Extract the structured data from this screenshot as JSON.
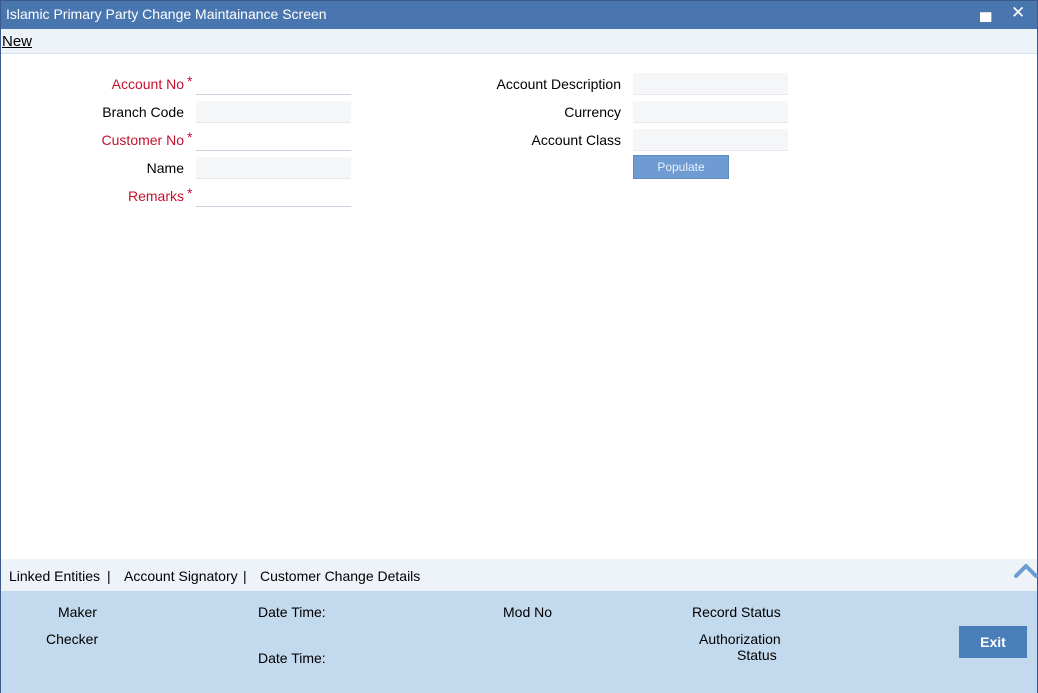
{
  "window": {
    "title": "Islamic Primary Party Change Maintainance Screen",
    "minimize_glyph": "▄",
    "close_glyph": "✕"
  },
  "toolbar": {
    "new_label": "New"
  },
  "form": {
    "account_no": {
      "label": "Account No",
      "value": ""
    },
    "branch_code": {
      "label": "Branch Code",
      "value": ""
    },
    "customer_no": {
      "label": "Customer No",
      "value": ""
    },
    "name": {
      "label": "Name",
      "value": ""
    },
    "remarks": {
      "label": "Remarks",
      "value": ""
    },
    "account_description": {
      "label": "Account Description",
      "value": ""
    },
    "currency": {
      "label": "Currency",
      "value": ""
    },
    "account_class": {
      "label": "Account Class",
      "value": ""
    },
    "required_marker": "*",
    "populate_label": "Populate"
  },
  "subsystems": {
    "tabs": [
      "Linked Entities",
      "Account Signatory",
      "Customer Change Details"
    ],
    "separator": "|",
    "collapse_icon": "chevron-up-icon"
  },
  "audit": {
    "maker_label": "Maker",
    "checker_label": "Checker",
    "date_time_label": "Date Time:",
    "mod_no_label": "Mod No",
    "record_status_label": "Record Status",
    "authorization_status_line1": "Authorization",
    "authorization_status_line2": "Status",
    "exit_label": "Exit"
  },
  "colors": {
    "title_bar": "#4a76b0",
    "required_label": "#c8102e",
    "footer_bg": "#c3d9ee",
    "exit_button": "#4a7eb8"
  }
}
